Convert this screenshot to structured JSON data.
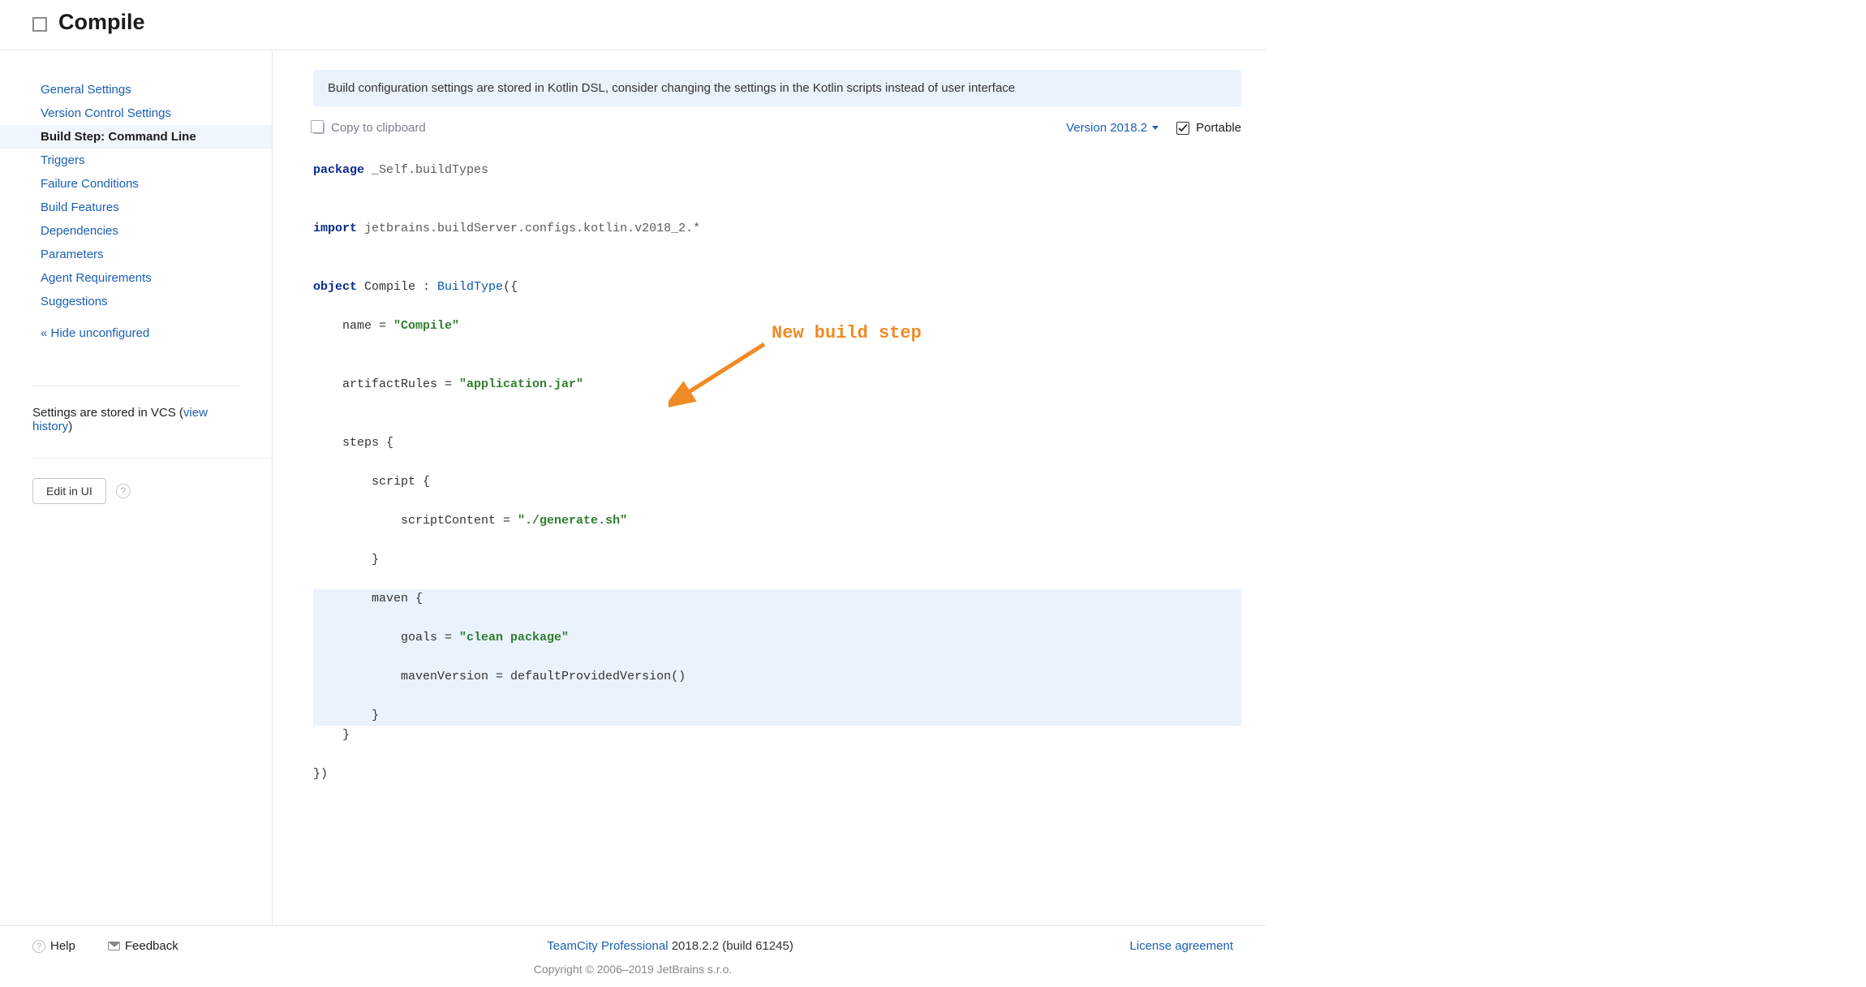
{
  "header": {
    "title": "Compile"
  },
  "sidebar": {
    "items": [
      {
        "label": "General Settings",
        "active": false
      },
      {
        "label": "Version Control Settings",
        "active": false
      },
      {
        "label": "Build Step: Command Line",
        "active": true
      },
      {
        "label": "Triggers",
        "active": false
      },
      {
        "label": "Failure Conditions",
        "active": false
      },
      {
        "label": "Build Features",
        "active": false
      },
      {
        "label": "Dependencies",
        "active": false
      },
      {
        "label": "Parameters",
        "active": false
      },
      {
        "label": "Agent Requirements",
        "active": false
      },
      {
        "label": "Suggestions",
        "active": false
      }
    ],
    "hide_unconfigured": "« Hide unconfigured",
    "vcs_note_prefix": "Settings are stored in VCS (",
    "vcs_note_link": "view history",
    "vcs_note_suffix": ")",
    "edit_label": "Edit in UI"
  },
  "main": {
    "banner": "Build configuration settings are stored in Kotlin DSL, consider changing the settings in the Kotlin scripts instead of user interface",
    "copy_label": "Copy to clipboard",
    "version_label": "Version 2018.2",
    "portable_label": "Portable",
    "annotation_text": "New build step",
    "code": {
      "package_kw": "package",
      "package_name": " _Self.buildTypes",
      "import_kw": "import",
      "import_path": " jetbrains.buildServer.configs.kotlin.v2018_2.*",
      "object_kw": "object",
      "object_name": " Compile : ",
      "build_type": "BuildType",
      "open": "({",
      "name_line_prefix": "    name = ",
      "name_value": "\"Compile\"",
      "artifact_prefix": "    artifactRules = ",
      "artifact_value": "\"application.jar\"",
      "steps_open": "    steps {",
      "script_open": "        script {",
      "script_content_prefix": "            scriptContent = ",
      "script_content_value": "\"./generate.sh\"",
      "script_close": "        }",
      "maven_open": "        maven {",
      "maven_goals_prefix": "            goals = ",
      "maven_goals_value": "\"clean package\"",
      "maven_version_line": "            mavenVersion = defaultProvidedVersion()",
      "maven_close": "        }",
      "steps_close": "    }",
      "object_close": "})"
    }
  },
  "footer": {
    "help": "Help",
    "feedback": "Feedback",
    "product": "TeamCity Professional",
    "version": " 2018.2.2 (build 61245)",
    "license": "License agreement",
    "copyright": "Copyright © 2006–2019 JetBrains s.r.o."
  }
}
